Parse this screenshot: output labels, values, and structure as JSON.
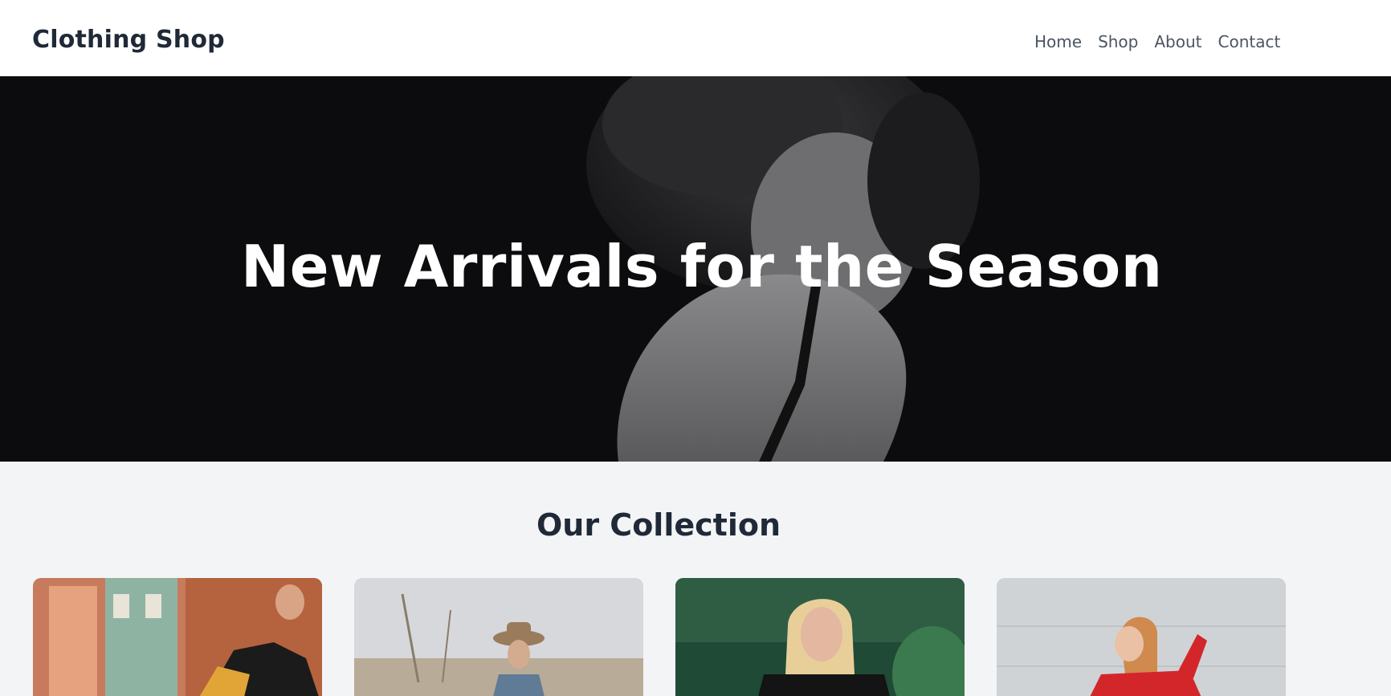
{
  "header": {
    "logo": "Clothing Shop",
    "nav": [
      "Home",
      "Shop",
      "About",
      "Contact"
    ]
  },
  "hero": {
    "title": "New Arrivals for the Season"
  },
  "collection": {
    "title": "Our Collection",
    "products": [
      {
        "image": "woman-in-yellow-pants-leather-jacket-street"
      },
      {
        "image": "woman-in-hat-denim-jacket-field"
      },
      {
        "image": "blonde-woman-off-shoulder-black-top"
      },
      {
        "image": "woman-in-red-sweatshirt"
      }
    ]
  },
  "colors": {
    "header_bg": "#ffffff",
    "text_dark": "#1f2937",
    "nav_text": "#4b5563",
    "hero_bg": "#0b0b0d",
    "page_bg": "#f3f4f6"
  }
}
